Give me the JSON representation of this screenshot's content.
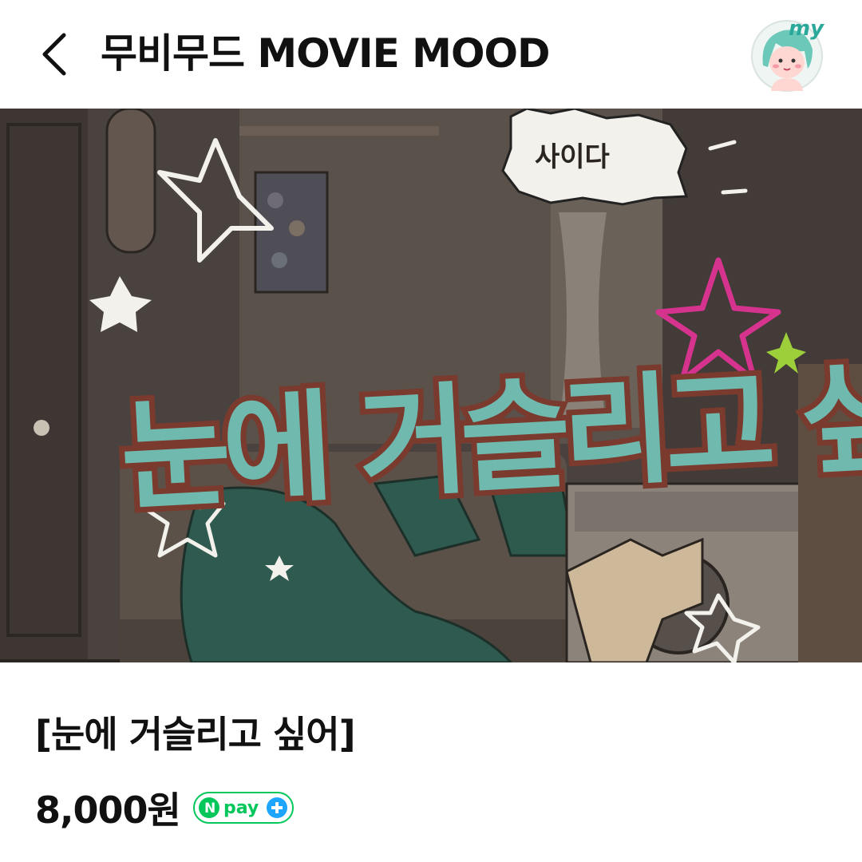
{
  "header": {
    "title": "무비무드 MOVIE MOOD",
    "avatar_label": "my"
  },
  "banner": {
    "headline": "눈에 거슬리고 싶어",
    "sticker_text": "사이다"
  },
  "product": {
    "title": "[눈에 거슬리고 싶어]",
    "price": "8,000원",
    "pay_badge": "pay"
  },
  "colors": {
    "teal": "#6fb9ae",
    "brown": "#7a3a2e",
    "npay_green": "#03c75a",
    "npay_blue": "#1ea5ff",
    "pink_star": "#d6338f",
    "lime_star": "#9ccf3a"
  }
}
